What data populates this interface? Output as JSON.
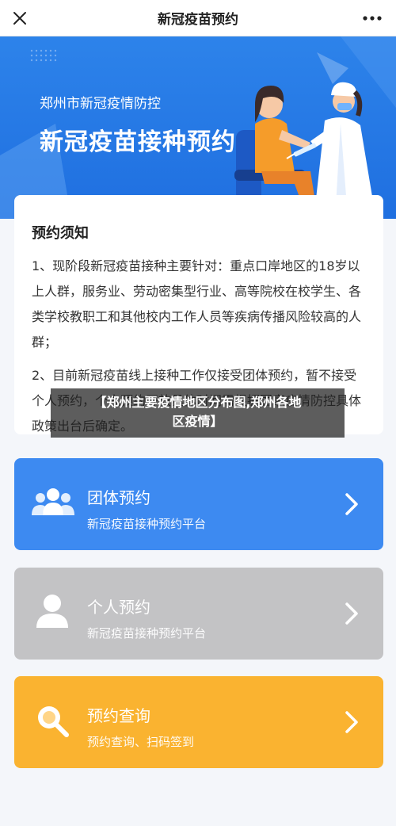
{
  "topbar": {
    "title": "新冠疫苗预约",
    "close_icon": "close-icon",
    "more_icon": "more-icon"
  },
  "banner": {
    "org": "郑州市新冠疫情防控",
    "headline": "新冠疫苗接种预约"
  },
  "notice": {
    "heading": "预约须知",
    "items": [
      "1、现阶段新冠疫苗接种主要针对：重点口岸地区的18岁以上人群，服务业、劳动密集型行业、高等院校在校学生、各类学校教职工和其他校内工作人员等疾病传播风险较高的人群；",
      "2、目前新冠疫苗线上接种工作仅接受团体预约，暂不接受个人预约，个人预约开放具体时间需根据国家疫情防控具体政策出台后确定。"
    ]
  },
  "overlay": {
    "line1": "【郑州主要疫情地区分布图,郑州各地",
    "line2": "区疫情】"
  },
  "cards": {
    "group": {
      "title": "团体预约",
      "subtitle": "新冠疫苗接种预约平台",
      "icon": "group-icon",
      "color": "#3d8af1"
    },
    "personal": {
      "title": "个人预约",
      "subtitle": "新冠疫苗接种预约平台",
      "icon": "person-icon",
      "color": "#c3c3c5"
    },
    "query": {
      "title": "预约查询",
      "subtitle": "预约查询、扫码签到",
      "icon": "search-icon",
      "color": "#fab330"
    }
  }
}
